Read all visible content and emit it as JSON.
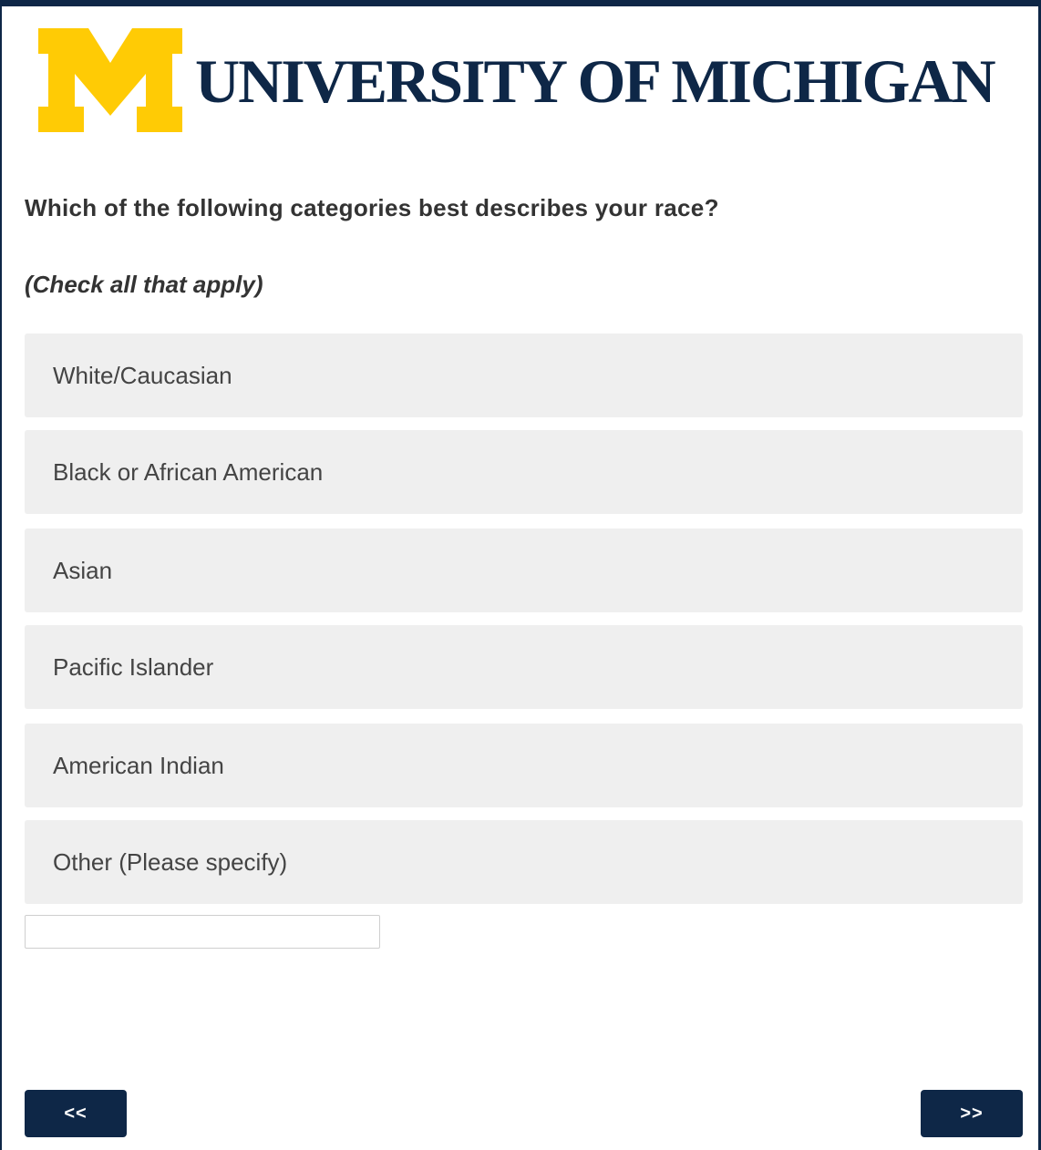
{
  "header": {
    "logo_icon": "block-m-logo",
    "logo_color": "#FFCB05",
    "wordmark": "UNIVERSITY OF MICHIGAN",
    "brand_color": "#0E2747"
  },
  "question": {
    "text": "Which of the following categories best describes your race?",
    "instruction": "(Check all that apply)"
  },
  "choices": [
    {
      "label": "White/Caucasian"
    },
    {
      "label": "Black or African American"
    },
    {
      "label": "Asian"
    },
    {
      "label": "Pacific Islander"
    },
    {
      "label": "American Indian"
    },
    {
      "label": "Other (Please specify)"
    }
  ],
  "other_input": {
    "value": "",
    "placeholder": ""
  },
  "navigation": {
    "back_label": "<<",
    "next_label": ">>"
  }
}
